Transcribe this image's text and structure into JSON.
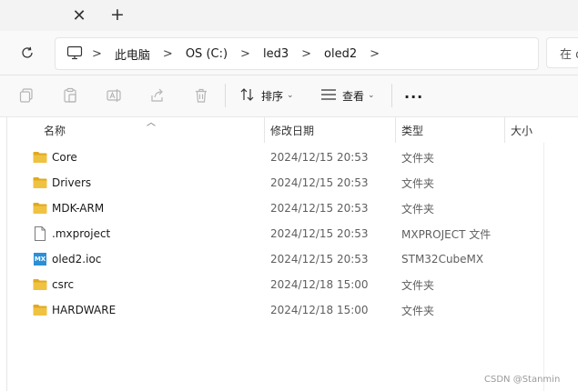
{
  "tabbar": {
    "close_glyph": "✕",
    "new_tab_glyph": "+"
  },
  "address": {
    "crumbs": [
      "此电脑",
      "OS (C:)",
      "led3",
      "oled2"
    ],
    "separator": ">"
  },
  "search": {
    "placeholder": "在 o"
  },
  "toolbar": {
    "sort_label": "排序",
    "view_label": "查看",
    "more_glyph": "···"
  },
  "columns": {
    "name": "名称",
    "date": "修改日期",
    "type": "类型",
    "size": "大小"
  },
  "files": [
    {
      "name": "Core",
      "date": "2024/12/15 20:53",
      "type": "文件夹",
      "icon": "folder-icon"
    },
    {
      "name": "Drivers",
      "date": "2024/12/15 20:53",
      "type": "文件夹",
      "icon": "folder-icon"
    },
    {
      "name": "MDK-ARM",
      "date": "2024/12/15 20:53",
      "type": "文件夹",
      "icon": "folder-icon"
    },
    {
      "name": ".mxproject",
      "date": "2024/12/15 20:53",
      "type": "MXPROJECT 文件",
      "icon": "document-icon"
    },
    {
      "name": "oled2.ioc",
      "date": "2024/12/15 20:53",
      "type": "STM32CubeMX",
      "icon": "stm32cubemx-icon",
      "icon_text": "MX"
    },
    {
      "name": "csrc",
      "date": "2024/12/18 15:00",
      "type": "文件夹",
      "icon": "folder-icon"
    },
    {
      "name": "HARDWARE",
      "date": "2024/12/18 15:00",
      "type": "文件夹",
      "icon": "folder-icon"
    }
  ],
  "watermark": "CSDN @Stanmin",
  "colors": {
    "folder": "#f0c241",
    "folder_dark": "#e0a920",
    "mx_badge": "#2b8fd6"
  }
}
